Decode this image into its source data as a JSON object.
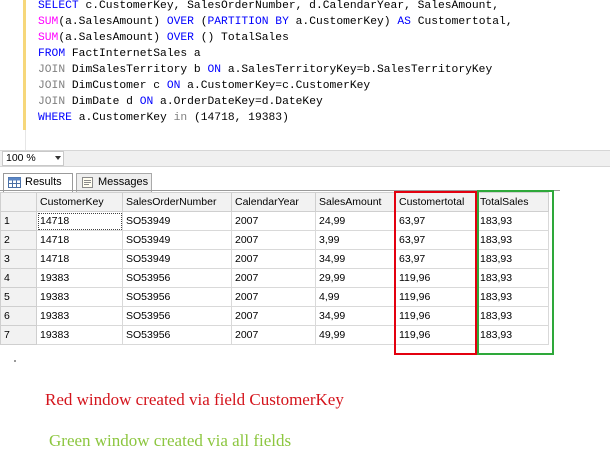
{
  "editor": {
    "sql_lines": [
      [
        {
          "t": "SELECT ",
          "c": "kw"
        },
        {
          "t": "c.CustomerKey, SalesOrderNumber, d.CalendarYear, SalesAmount,",
          "c": "tx"
        }
      ],
      [
        {
          "t": "SUM",
          "c": "fn"
        },
        {
          "t": "(a.SalesAmount) ",
          "c": "tx"
        },
        {
          "t": "OVER ",
          "c": "kw"
        },
        {
          "t": "(",
          "c": "tx"
        },
        {
          "t": "PARTITION BY ",
          "c": "kw"
        },
        {
          "t": "a.CustomerKey) ",
          "c": "tx"
        },
        {
          "t": "AS ",
          "c": "kw"
        },
        {
          "t": "Customertotal,",
          "c": "tx"
        }
      ],
      [
        {
          "t": "SUM",
          "c": "fn"
        },
        {
          "t": "(a.SalesAmount) ",
          "c": "tx"
        },
        {
          "t": "OVER ",
          "c": "kw"
        },
        {
          "t": "() TotalSales",
          "c": "tx"
        }
      ],
      [
        {
          "t": "FROM ",
          "c": "kw"
        },
        {
          "t": "FactInternetSales a",
          "c": "tx"
        }
      ],
      [
        {
          "t": "JOIN ",
          "c": "op"
        },
        {
          "t": "DimSalesTerritory b ",
          "c": "tx"
        },
        {
          "t": "ON ",
          "c": "kw"
        },
        {
          "t": "a.SalesTerritoryKey=b.SalesTerritoryKey",
          "c": "tx"
        }
      ],
      [
        {
          "t": "JOIN ",
          "c": "op"
        },
        {
          "t": "DimCustomer c ",
          "c": "tx"
        },
        {
          "t": "ON ",
          "c": "kw"
        },
        {
          "t": "a.CustomerKey=c.CustomerKey",
          "c": "tx"
        }
      ],
      [
        {
          "t": "JOIN ",
          "c": "op"
        },
        {
          "t": "DimDate d ",
          "c": "tx"
        },
        {
          "t": "ON ",
          "c": "kw"
        },
        {
          "t": "a.OrderDateKey=d.DateKey",
          "c": "tx"
        }
      ],
      [
        {
          "t": "WHERE ",
          "c": "kw"
        },
        {
          "t": "a.CustomerKey ",
          "c": "tx"
        },
        {
          "t": "in ",
          "c": "op"
        },
        {
          "t": "(14718, 19383)",
          "c": "tx"
        }
      ]
    ]
  },
  "zoom": {
    "value": "100 %"
  },
  "tabs": {
    "results_label": "Results",
    "messages_label": "Messages"
  },
  "grid": {
    "columns": [
      "CustomerKey",
      "SalesOrderNumber",
      "CalendarYear",
      "SalesAmount",
      "Customertotal",
      "TotalSales"
    ],
    "rows": [
      {
        "num": "1",
        "cells": [
          "14718",
          "SO53949",
          "2007",
          "24,99",
          "63,97",
          "183,93"
        ]
      },
      {
        "num": "2",
        "cells": [
          "14718",
          "SO53949",
          "2007",
          "3,99",
          "63,97",
          "183,93"
        ]
      },
      {
        "num": "3",
        "cells": [
          "14718",
          "SO53949",
          "2007",
          "34,99",
          "63,97",
          "183,93"
        ]
      },
      {
        "num": "4",
        "cells": [
          "19383",
          "SO53956",
          "2007",
          "29,99",
          "119,96",
          "183,93"
        ]
      },
      {
        "num": "5",
        "cells": [
          "19383",
          "SO53956",
          "2007",
          "4,99",
          "119,96",
          "183,93"
        ]
      },
      {
        "num": "6",
        "cells": [
          "19383",
          "SO53956",
          "2007",
          "34,99",
          "119,96",
          "183,93"
        ]
      },
      {
        "num": "7",
        "cells": [
          "19383",
          "SO53956",
          "2007",
          "49,99",
          "119,96",
          "183,93"
        ]
      }
    ]
  },
  "annotations": {
    "red_caption": "Red window created via field CustomerKey",
    "green_caption": "Green window created via all fields",
    "red_color": "#e3000f",
    "green_color": "#2ea83a"
  }
}
